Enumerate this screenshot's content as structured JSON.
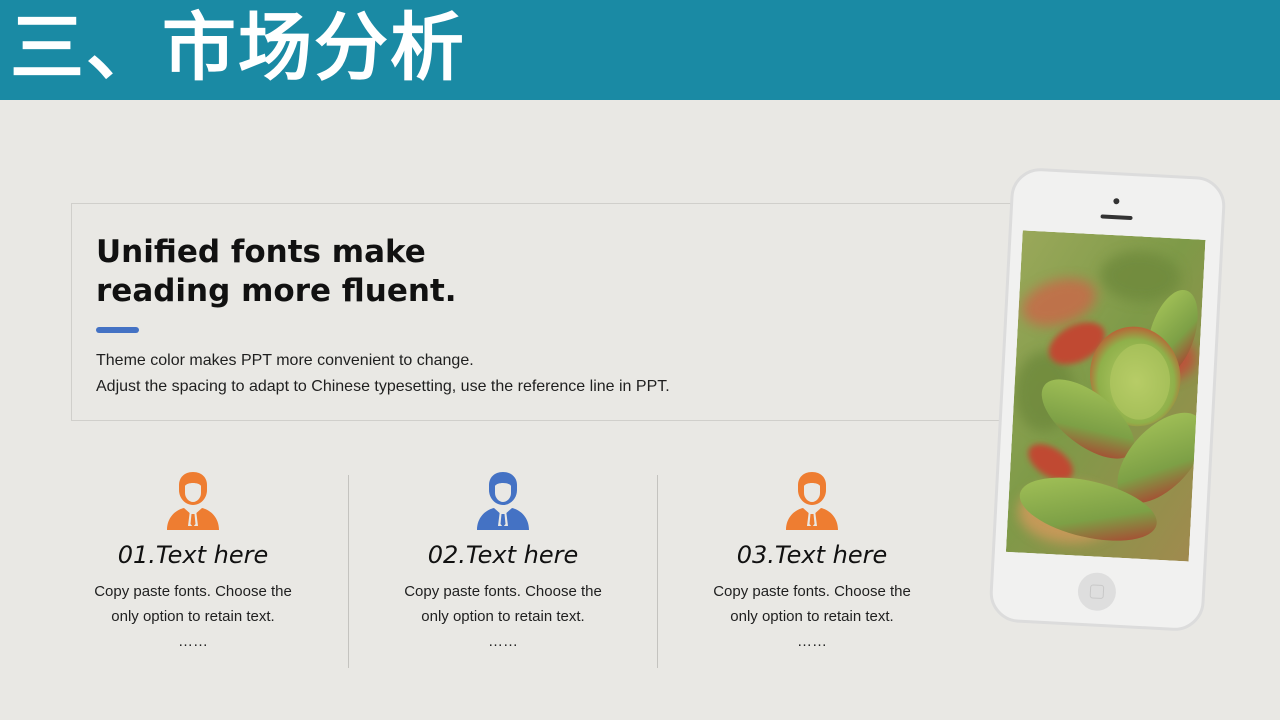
{
  "header": {
    "title": "三、市场分析"
  },
  "intro": {
    "heading_line1": "Unified fonts make",
    "heading_line2": "reading more fluent.",
    "line1": "Theme color makes PPT more convenient to change.",
    "line2": "Adjust the spacing to adapt to Chinese typesetting, use the reference line in PPT."
  },
  "features": [
    {
      "icon": "person-icon",
      "icon_color": "#ee7d31",
      "title": "01.Text here",
      "line1": "Copy paste fonts. Choose the",
      "line2": "only option to retain text.",
      "line3": "……"
    },
    {
      "icon": "person-icon",
      "icon_color": "#4472c4",
      "title": "02.Text here",
      "line1": "Copy paste fonts. Choose the",
      "line2": "only option to retain text.",
      "line3": "……"
    },
    {
      "icon": "person-icon",
      "icon_color": "#ee7d31",
      "title": "03.Text here",
      "line1": "Copy paste fonts. Choose the",
      "line2": "only option to retain text.",
      "line3": "……"
    }
  ],
  "colors": {
    "header_bg": "#1a8aa4",
    "accent_blue": "#4472c4",
    "accent_orange": "#ee7d31",
    "page_bg": "#e9e8e4"
  },
  "phone": {
    "icon": "smartphone-icon",
    "screen_image": "succulent-plant-photo"
  }
}
